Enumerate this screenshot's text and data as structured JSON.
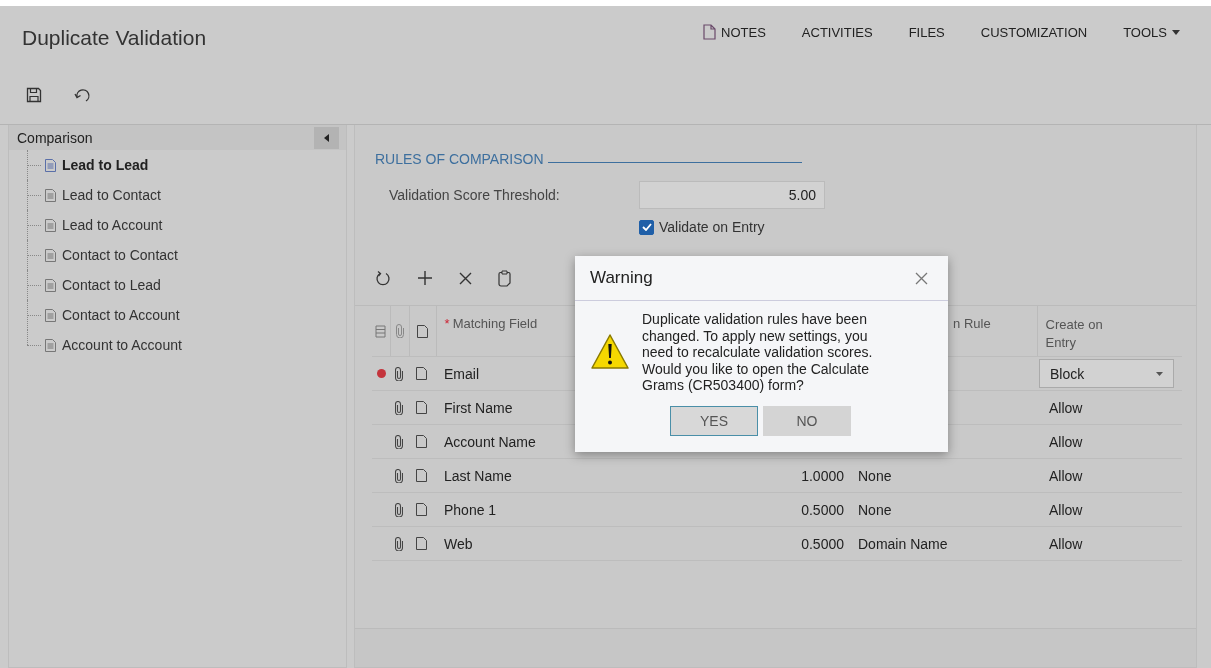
{
  "page": {
    "title": "Duplicate Validation"
  },
  "top_menu": [
    {
      "label": "NOTES",
      "kind": "notes"
    },
    {
      "label": "ACTIVITIES",
      "kind": "plain"
    },
    {
      "label": "FILES",
      "kind": "plain"
    },
    {
      "label": "CUSTOMIZATION",
      "kind": "plain"
    },
    {
      "label": "TOOLS",
      "kind": "dropdown"
    }
  ],
  "sidebar": {
    "title": "Comparison",
    "items": [
      {
        "label": "Lead to Lead",
        "selected": true
      },
      {
        "label": "Lead to Contact",
        "selected": false
      },
      {
        "label": "Lead to Account",
        "selected": false
      },
      {
        "label": "Contact to Contact",
        "selected": false
      },
      {
        "label": "Contact to Lead",
        "selected": false
      },
      {
        "label": "Contact to Account",
        "selected": false
      },
      {
        "label": "Account to Account",
        "selected": false
      }
    ]
  },
  "rules": {
    "section_title": "RULES OF COMPARISON",
    "threshold_label": "Validation Score Threshold:",
    "threshold_value": "5.00",
    "validate_on_entry": {
      "label": "Validate on Entry",
      "checked": true
    }
  },
  "table": {
    "columns": [
      {
        "label": "Matching Field",
        "marker": "*"
      },
      {
        "label": "n Rule"
      },
      {
        "label": "Create on Entry"
      }
    ],
    "rows": [
      {
        "field": "Email",
        "modified": true,
        "create": "Block",
        "editing": true
      },
      {
        "field": "First Name",
        "modified": false,
        "create": "Allow",
        "editing": false
      },
      {
        "field": "Account Name",
        "modified": false,
        "create": "Allow",
        "editing": false
      },
      {
        "field": "Last Name",
        "modified": false,
        "score": "1.0000",
        "rule": "None",
        "create": "Allow",
        "editing": false
      },
      {
        "field": "Phone 1",
        "modified": false,
        "score": "0.5000",
        "rule": "None",
        "create": "Allow",
        "editing": false
      },
      {
        "field": "Web",
        "modified": false,
        "score": "0.5000",
        "rule": "Domain Name",
        "create": "Allow",
        "editing": false
      }
    ]
  },
  "dialog": {
    "title": "Warning",
    "message": "Duplicate validation rules have been changed. To apply new settings, you need to recalculate validation scores. Would you like to open the Calculate Grams (CR503400) form?",
    "buttons": [
      {
        "label": "YES",
        "selected": true
      },
      {
        "label": "NO",
        "selected": false
      }
    ]
  }
}
